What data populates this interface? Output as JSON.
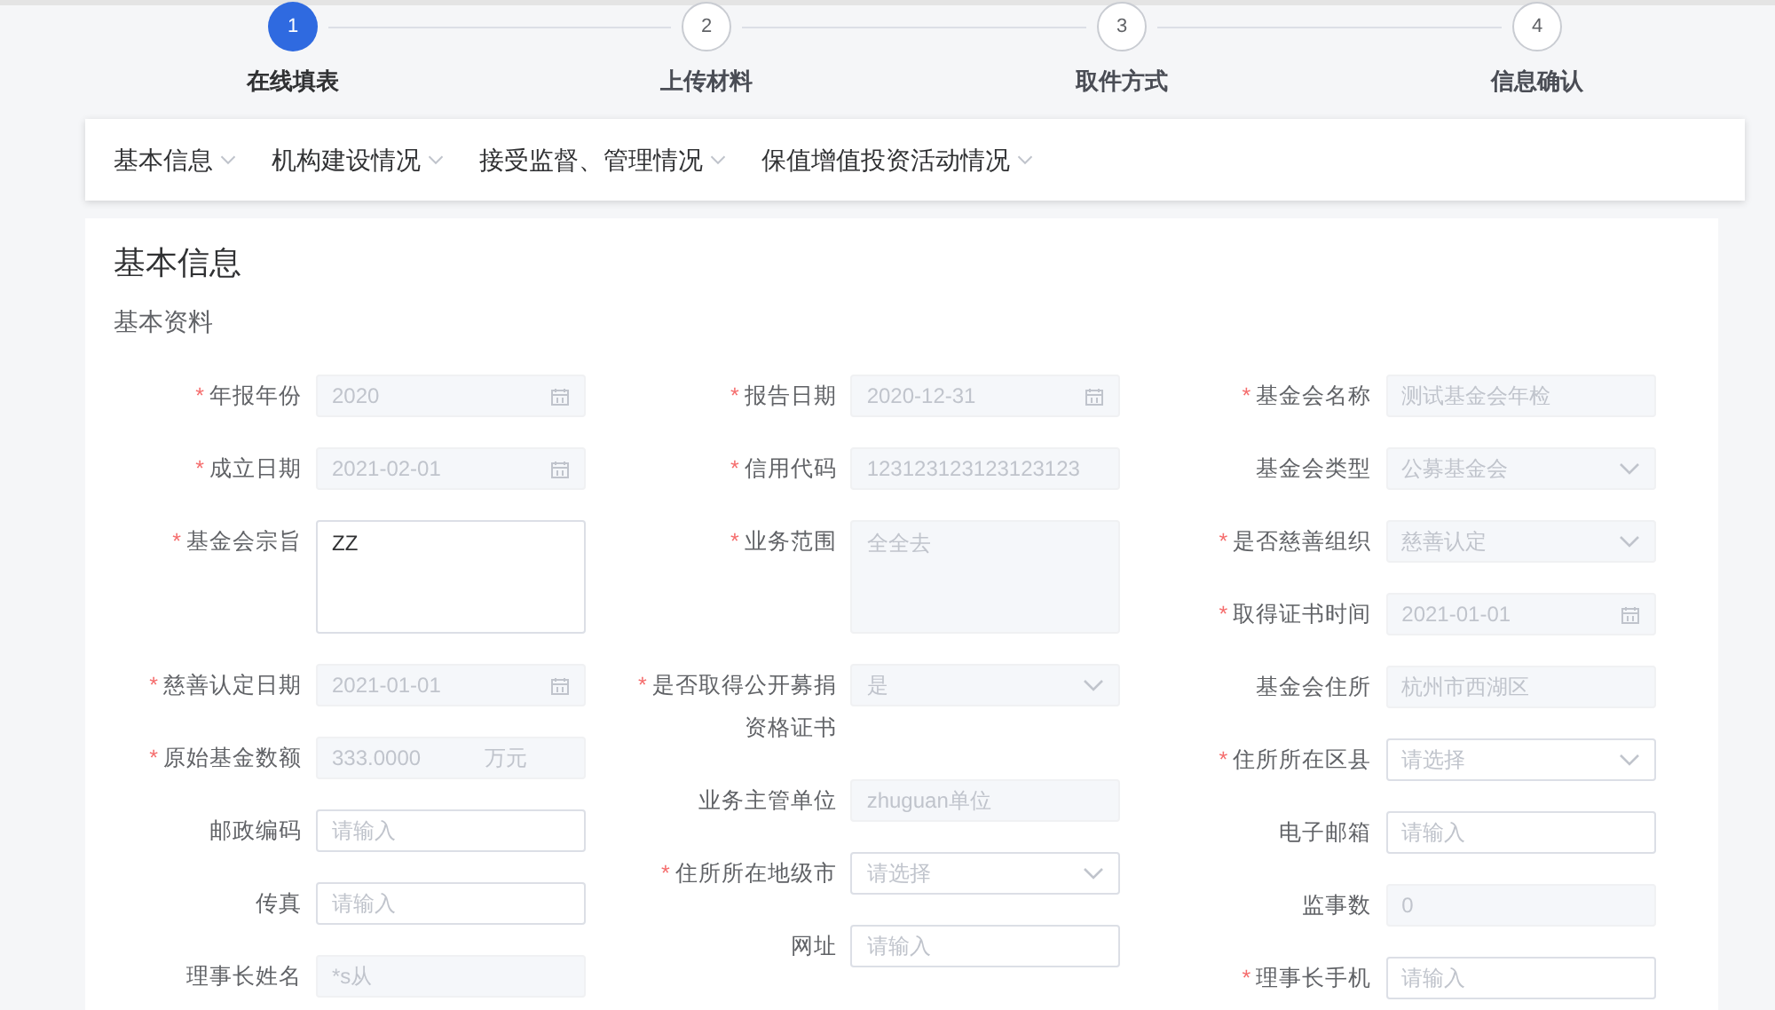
{
  "steps": [
    {
      "number": "1",
      "label": "在线填表",
      "selected": true
    },
    {
      "number": "2",
      "label": "上传材料",
      "selected": false
    },
    {
      "number": "3",
      "label": "取件方式",
      "selected": false
    },
    {
      "number": "4",
      "label": "信息确认",
      "selected": false
    }
  ],
  "tabs": [
    "基本信息",
    "机构建设情况",
    "接受监督、管理情况",
    "保值增值投资活动情况"
  ],
  "form": {
    "title": "基本信息",
    "section": "基本资料",
    "columns": [
      [
        {
          "label": "年报年份",
          "required_mark": "*",
          "kind": "date",
          "value": "2020",
          "disabled": true
        },
        {
          "label": "成立日期",
          "required_mark": "*",
          "kind": "date",
          "value": "2021-02-01",
          "disabled": true
        },
        {
          "label": "基金会宗旨",
          "required_mark": "*",
          "kind": "textarea",
          "value": "ZZ",
          "disabled": false
        },
        {
          "label": "慈善认定日期",
          "required_mark": "*",
          "kind": "date",
          "value": "2021-01-01",
          "disabled": true
        },
        {
          "label": "原始基金数额",
          "required_mark": "*",
          "kind": "amount",
          "value": "333.0000",
          "unit": "万元",
          "disabled": true
        },
        {
          "label": "邮政编码",
          "kind": "text",
          "placeholder": "请输入",
          "disabled": false
        },
        {
          "label": "传真",
          "kind": "text",
          "placeholder": "请输入",
          "disabled": false
        },
        {
          "label": "理事长姓名",
          "kind": "text",
          "value": "*s从",
          "disabled": true
        }
      ],
      [
        {
          "label": "报告日期",
          "required_mark": "*",
          "kind": "date",
          "value": "2020-12-31",
          "disabled": true
        },
        {
          "label": "信用代码",
          "required_mark": "*",
          "kind": "text",
          "value": "123123123123123123",
          "disabled": true
        },
        {
          "label": "业务范围",
          "required_mark": "*",
          "kind": "textarea",
          "value": "全全去",
          "disabled": true
        },
        {
          "label": "是否取得公开募捐资格证书",
          "required_mark": "*",
          "kind": "select",
          "value": "是",
          "disabled": true
        },
        {
          "label": "业务主管单位",
          "kind": "text",
          "value": "zhuguan单位",
          "disabled": true
        },
        {
          "label": "住所所在地级市",
          "required_mark": "*",
          "kind": "select",
          "placeholder": "请选择",
          "disabled": false
        },
        {
          "label": "网址",
          "kind": "text",
          "placeholder": "请输入",
          "disabled": false
        }
      ],
      [
        {
          "label": "基金会名称",
          "required_mark": "*",
          "kind": "text",
          "value": "测试基金会年检",
          "disabled": true
        },
        {
          "label": "基金会类型",
          "kind": "select",
          "value": "公募基金会",
          "disabled": true
        },
        {
          "label": "是否慈善组织",
          "required_mark": "*",
          "kind": "select",
          "value": "慈善认定",
          "disabled": true
        },
        {
          "label": "取得证书时间",
          "required_mark": "*",
          "kind": "date",
          "value": "2021-01-01",
          "disabled": true
        },
        {
          "label": "基金会住所",
          "kind": "text",
          "value": "杭州市西湖区",
          "disabled": true
        },
        {
          "label": "住所所在区县",
          "required_mark": "*",
          "kind": "select",
          "placeholder": "请选择",
          "disabled": false
        },
        {
          "label": "电子邮箱",
          "kind": "text",
          "placeholder": "请输入",
          "disabled": false
        },
        {
          "label": "监事数",
          "kind": "text",
          "value": "0",
          "disabled": true
        },
        {
          "label": "理事长手机",
          "required_mark": "*",
          "kind": "text",
          "placeholder": "请输入",
          "disabled": false
        }
      ]
    ]
  }
}
